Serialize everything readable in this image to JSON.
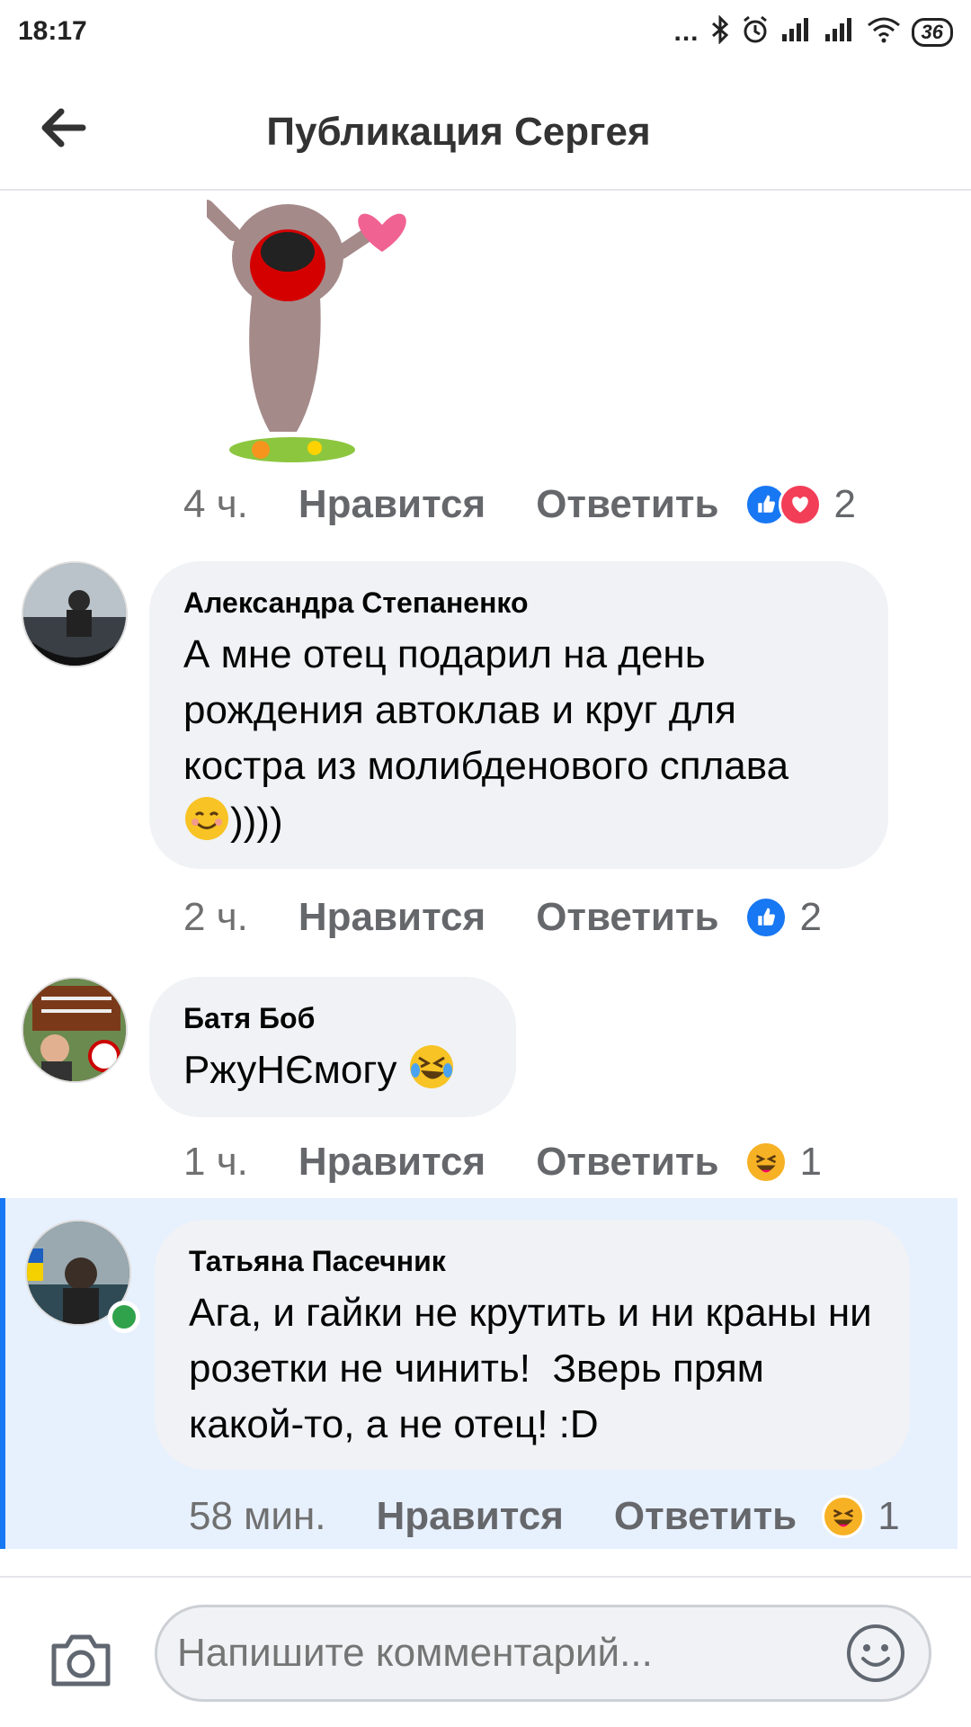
{
  "status_bar": {
    "time": "18:17",
    "dots": "...",
    "battery": "36",
    "icons": [
      "bluetooth-icon",
      "alarm-icon",
      "signal-icon",
      "signal-icon",
      "wifi-icon",
      "battery-icon"
    ]
  },
  "header": {
    "title": "Публикация Сергея",
    "back_icon": "back-arrow-icon"
  },
  "sticker": {
    "icon": "dancing-pug-sticker-icon"
  },
  "comments": [
    {
      "time": "4 ч.",
      "like_label": "Нравится",
      "reply_label": "Ответить",
      "reactions": [
        "like",
        "love"
      ],
      "reaction_count": "2"
    },
    {
      "author": "Александра Степаненко",
      "text": "А мне отец подарил на день рождения автоклав и круг для костра из молибденового сплава",
      "text_suffix": "))))",
      "time": "2 ч.",
      "like_label": "Нравится",
      "reply_label": "Ответить",
      "reactions": [
        "like"
      ],
      "reaction_count": "2"
    },
    {
      "author": "Батя Боб",
      "text": "РжуНЄмогу",
      "time": "1 ч.",
      "like_label": "Нравится",
      "reply_label": "Ответить",
      "reactions": [
        "haha"
      ],
      "reaction_count": "1"
    },
    {
      "author": "Татьяна Пасечник",
      "text": "Ага, и гайки не крутить и ни краны ни розетки не чинить!  Зверь прям какой-то, а не отец! :D",
      "time": "58 мин.",
      "like_label": "Нравится",
      "reply_label": "Ответить",
      "reactions": [
        "haha"
      ],
      "reaction_count": "1",
      "online": true
    }
  ],
  "composer": {
    "placeholder": "Напишите комментарий...",
    "camera_icon": "camera-icon",
    "emoji_icon": "smiley-icon"
  },
  "colors": {
    "accent": "#1877f2",
    "love": "#f33e58",
    "haha": "#f7b125",
    "bubble": "#f0f2f5",
    "highlight": "#e7f0fd",
    "online": "#31a24c"
  }
}
